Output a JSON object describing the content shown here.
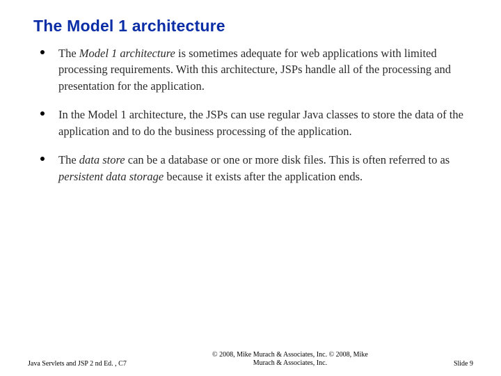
{
  "title": "The Model 1 architecture",
  "bullets": [
    {
      "segments": [
        {
          "text": "The ",
          "italic": false
        },
        {
          "text": "Model 1 architecture",
          "italic": true
        },
        {
          "text": " is sometimes adequate for web applications with limited processing requirements. With this architecture, JSPs handle all of the processing and presentation for the application.",
          "italic": false
        }
      ]
    },
    {
      "segments": [
        {
          "text": "In the Model 1 architecture, the JSPs can use regular Java classes to store the data of the application and to do the business processing of the application.",
          "italic": false
        }
      ]
    },
    {
      "segments": [
        {
          "text": "The ",
          "italic": false
        },
        {
          "text": "data store",
          "italic": true
        },
        {
          "text": " can be a database or one or more disk files. This is often referred to as ",
          "italic": false
        },
        {
          "text": "persistent data storage",
          "italic": true
        },
        {
          "text": " because it exists after the application ends.",
          "italic": false
        }
      ]
    }
  ],
  "footer": {
    "left": "Java Servlets and JSP 2 nd Ed. , C7",
    "center_line1": "© 2008, Mike Murach & Associates, Inc. © 2008, Mike",
    "center_line2": "Murach & Associates, Inc.",
    "right": "Slide 9"
  }
}
